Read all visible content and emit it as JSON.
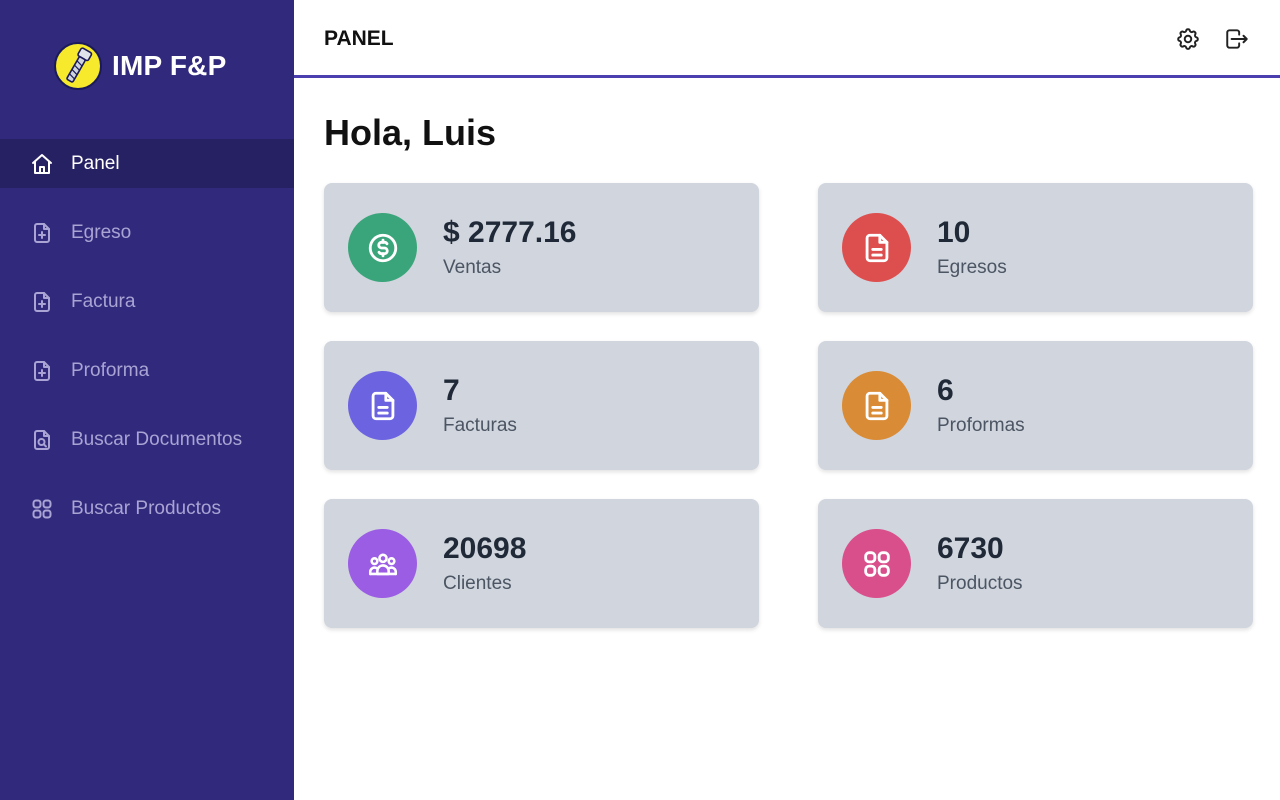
{
  "brand": {
    "name": "IMP F&P"
  },
  "sidebar": {
    "items": [
      {
        "label": "Panel",
        "icon": "home-icon",
        "active": true
      },
      {
        "label": "Egreso",
        "icon": "file-plus-icon",
        "active": false
      },
      {
        "label": "Factura",
        "icon": "file-plus-icon",
        "active": false
      },
      {
        "label": "Proforma",
        "icon": "file-plus-icon",
        "active": false
      },
      {
        "label": "Buscar Documentos",
        "icon": "file-search-icon",
        "active": false
      },
      {
        "label": "Buscar Productos",
        "icon": "grid-icon",
        "active": false
      }
    ]
  },
  "header": {
    "title": "PANEL",
    "actions": [
      {
        "icon": "gear-icon"
      },
      {
        "icon": "logout-icon"
      }
    ]
  },
  "main": {
    "greeting": "Hola, Luis",
    "cards": [
      {
        "value": "$ 2777.16",
        "label": "Ventas",
        "icon": "dollar-icon",
        "color": "#3aa57a"
      },
      {
        "value": "10",
        "label": "Egresos",
        "icon": "document-icon",
        "color": "#dd4f4f"
      },
      {
        "value": "7",
        "label": "Facturas",
        "icon": "document-icon",
        "color": "#6c63e0"
      },
      {
        "value": "6",
        "label": "Proformas",
        "icon": "document-icon",
        "color": "#d98b35"
      },
      {
        "value": "20698",
        "label": "Clientes",
        "icon": "users-icon",
        "color": "#9a5de3"
      },
      {
        "value": "6730",
        "label": "Productos",
        "icon": "grid-icon",
        "color": "#d94f8c"
      }
    ]
  },
  "colors": {
    "sidebar_bg": "#312a7c",
    "sidebar_active_bg": "#262163",
    "accent_line": "#4b3fb0",
    "card_bg": "#d1d5dd"
  }
}
